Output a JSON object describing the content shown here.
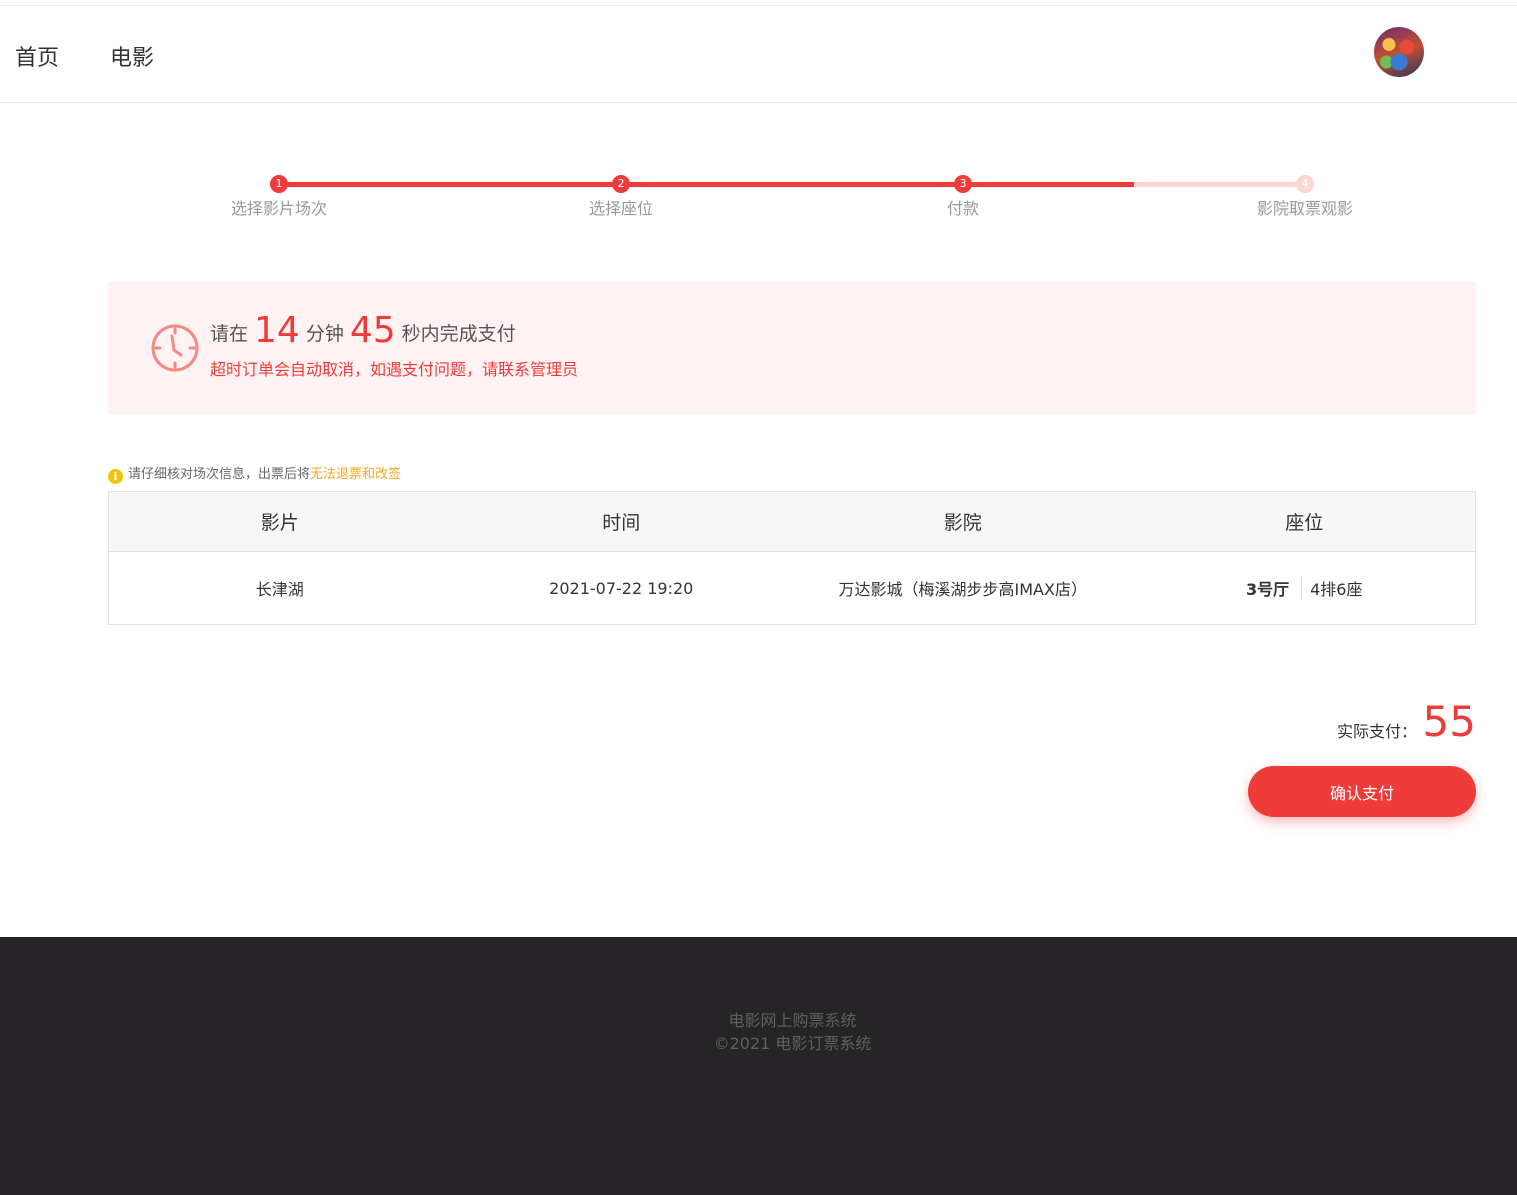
{
  "nav": {
    "home_label": "首页",
    "movie_label": "电影"
  },
  "steps": [
    {
      "num": "1",
      "label": "选择影片场次",
      "state": "done"
    },
    {
      "num": "2",
      "label": "选择座位",
      "state": "done"
    },
    {
      "num": "3",
      "label": "付款",
      "state": "current"
    },
    {
      "num": "4",
      "label": "影院取票观影",
      "state": "todo"
    }
  ],
  "countdown": {
    "prefix": "请在",
    "minutes": "14",
    "minutes_unit": "分钟",
    "seconds": "45",
    "suffix": "秒内完成支付",
    "warning": "超时订单会自动取消，如遇支付问题，请联系管理员"
  },
  "notice": {
    "icon": "info-icon",
    "text": "请仔细核对场次信息，出票后将",
    "warn": "无法退票和改签"
  },
  "table": {
    "headers": [
      "影片",
      "时间",
      "影院",
      "座位"
    ],
    "row": {
      "movie": "长津湖",
      "time": "2021-07-22 19:20",
      "cinema": "万达影城（梅溪湖步步高IMAX店）",
      "hall": "3号厅",
      "seat": "4排6座"
    }
  },
  "payment": {
    "label": "实际支付：",
    "amount": "55",
    "button_label": "确认支付"
  },
  "footer": {
    "line1": "电影网上购票系统",
    "line2": "©2021 电影订票系统"
  },
  "colors": {
    "accent": "#ef3c3a",
    "step_inactive": "#fcd5d6",
    "countdown_bg": "#fff2f2",
    "warn": "#f5a623",
    "footer_bg": "#262426"
  }
}
